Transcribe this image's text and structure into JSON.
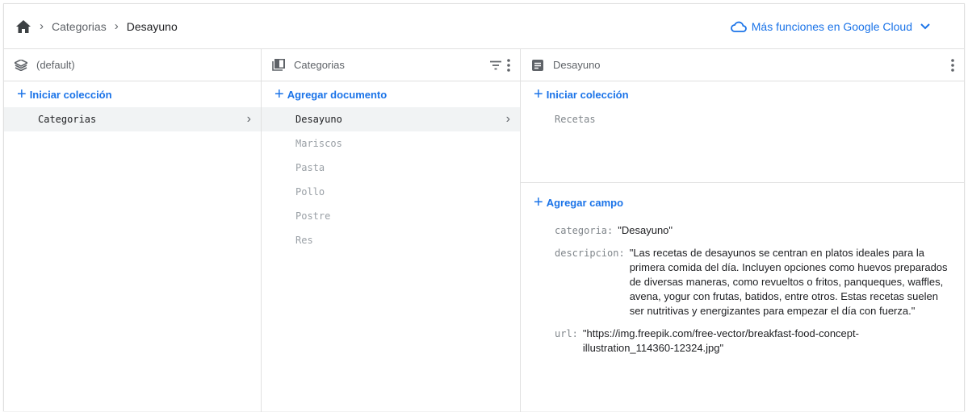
{
  "breadcrumb": {
    "items": [
      "Categorias",
      "Desayuno"
    ]
  },
  "gcloud": {
    "label": "Más funciones en Google Cloud"
  },
  "columns": {
    "root": {
      "title": "(default)",
      "action": "Iniciar colección",
      "items": [
        {
          "label": "Categorias"
        }
      ]
    },
    "collection": {
      "title": "Categorias",
      "action": "Agregar documento",
      "items": [
        {
          "label": "Desayuno"
        },
        {
          "label": "Mariscos"
        },
        {
          "label": "Pasta"
        },
        {
          "label": "Pollo"
        },
        {
          "label": "Postre"
        },
        {
          "label": "Res"
        }
      ]
    },
    "document": {
      "title": "Desayuno",
      "collection_action": "Iniciar colección",
      "subcollections": [
        {
          "label": "Recetas"
        }
      ],
      "field_action": "Agregar campo",
      "fields": [
        {
          "key": "categoria:",
          "value": "Desayuno"
        },
        {
          "key": "descripcion:",
          "value": "Las recetas de desayunos se centran en platos ideales para la primera comida del día. Incluyen opciones como huevos preparados de diversas maneras, como revueltos o fritos, panqueques, waffles, avena, yogur con frutas, batidos, entre otros. Estas recetas suelen ser nutritivas y energizantes para empezar el día con fuerza."
        },
        {
          "key": "url:",
          "value": "https://img.freepik.com/free-vector/breakfast-food-concept-illustration_114360-12324.jpg"
        }
      ]
    }
  },
  "colors": {
    "accent": "#1a73e8",
    "text": "#202124",
    "muted": "#5f6368"
  }
}
